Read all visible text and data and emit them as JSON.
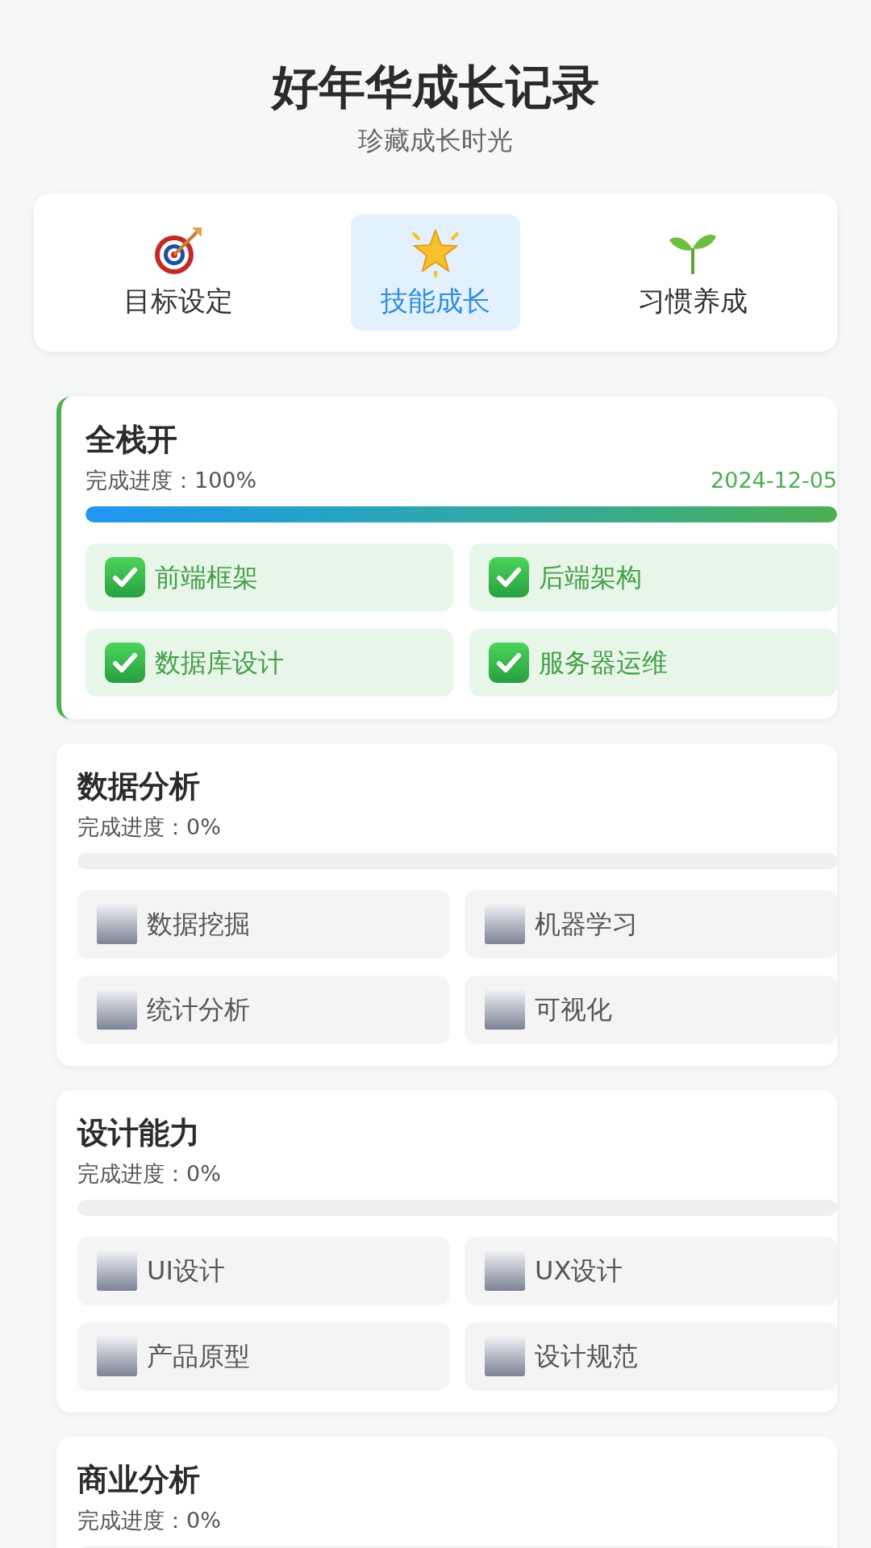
{
  "header": {
    "title": "好年华成长记录",
    "subtitle": "珍藏成长时光"
  },
  "tabs": [
    {
      "label": "目标设定",
      "selected": false
    },
    {
      "label": "技能成长",
      "selected": true
    },
    {
      "label": "习惯养成",
      "selected": false
    }
  ],
  "skills": [
    {
      "title": "全栈开",
      "progress": "完成进度：100%",
      "date": "2024-12-05",
      "level": 1,
      "items": [
        {
          "label": "前端框架",
          "checked": true
        },
        {
          "label": "后端架构",
          "checked": true
        },
        {
          "label": "数据库设计",
          "checked": true
        },
        {
          "label": "服务器运维",
          "checked": true
        }
      ]
    },
    {
      "title": "数据分析",
      "progress": "完成进度：0%",
      "level": 0,
      "items": [
        {
          "label": "数据挖掘",
          "checked": false
        },
        {
          "label": "机器学习",
          "checked": false
        },
        {
          "label": "统计分析",
          "checked": false
        },
        {
          "label": "可视化",
          "checked": false
        }
      ]
    },
    {
      "title": "设计能力",
      "progress": "完成进度：0%",
      "level": 0,
      "items": [
        {
          "label": "UI设计",
          "checked": false
        },
        {
          "label": "UX设计",
          "checked": false
        },
        {
          "label": "产品原型",
          "checked": false
        },
        {
          "label": "设计规范",
          "checked": false
        }
      ]
    },
    {
      "title": "商业分析",
      "progress": "完成进度：0%",
      "level": 0
    }
  ]
}
